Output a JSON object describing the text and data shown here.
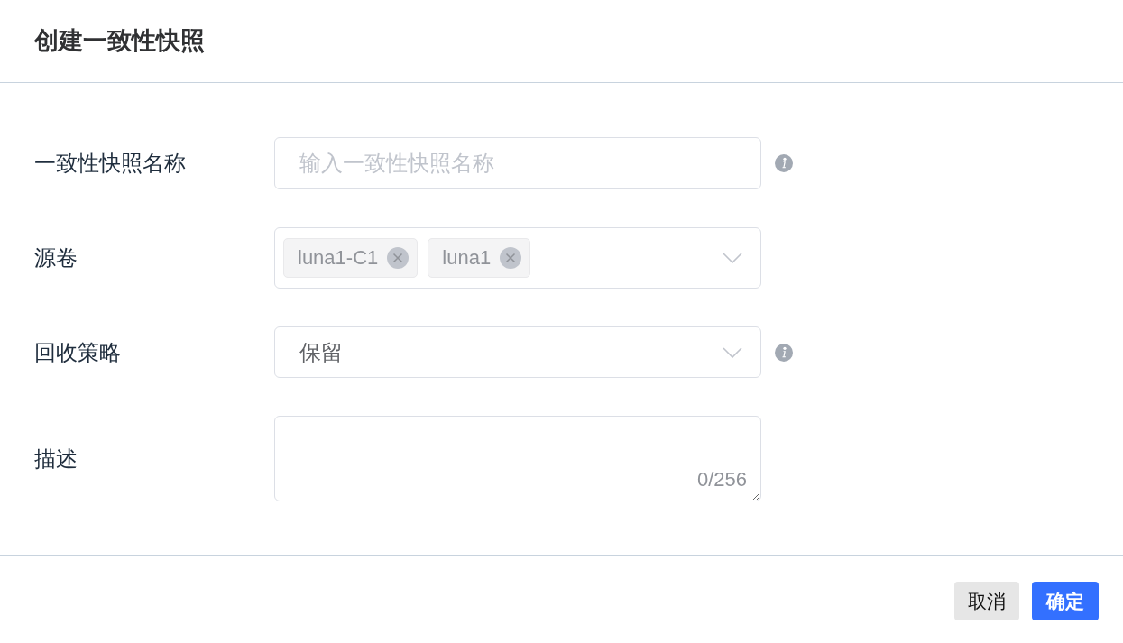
{
  "dialog": {
    "title": "创建一致性快照"
  },
  "fields": [
    {
      "kind": "text",
      "label": "一致性快照名称",
      "placeholder": "输入一致性快照名称",
      "info": true
    },
    {
      "kind": "multiselect",
      "label": "源卷",
      "tags": [
        "luna1-C1",
        "luna1"
      ],
      "info": false
    },
    {
      "kind": "select",
      "label": "回收策略",
      "value": "保留",
      "info": true
    },
    {
      "kind": "textarea",
      "label": "描述",
      "counter": "0/256",
      "info": false
    }
  ],
  "buttons": [
    {
      "label": "取消",
      "kind": "secondary"
    },
    {
      "label": "确定",
      "kind": "primary"
    }
  ]
}
